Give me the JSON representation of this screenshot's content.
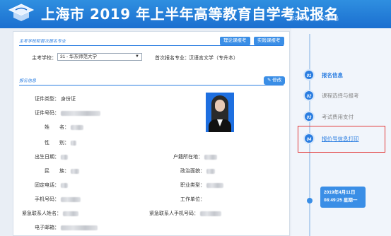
{
  "header": {
    "title": "上海市 2019 年上半年高等教育自学考试报名",
    "links": [
      "修改密码",
      "|",
      "安全退出"
    ]
  },
  "section1": {
    "title": "主考学校和首次报名专业",
    "buttons": [
      "理论课报考",
      "实践课报考"
    ],
    "school_label": "主考学校：",
    "school_value": "31 - 华东师范大学",
    "major_label": "首次报名专业：",
    "major_value": "汉语言文学（专升本）"
  },
  "section2": {
    "title": "报名信息",
    "edit_button": "修改",
    "fields": {
      "id_type_label": "证件类型：",
      "id_type_value": "身份证",
      "id_no_label": "证件号码：",
      "name_label": "姓　　名：",
      "gender_label": "性　　别：",
      "birth_label": "出生日期：",
      "ethnic_label": "民　　族：",
      "phone_label": "固定电话：",
      "mobile_label": "手机号码：",
      "emergency_name_label": "紧急联系人姓名：",
      "email_label": "电子邮箱：",
      "household_label": "户籍所在地：",
      "political_label": "政治面貌：",
      "occupation_label": "职业类型：",
      "workplace_label": "工作单位：",
      "emergency_mobile_label": "紧急联系人手机号码："
    }
  },
  "timeline": {
    "steps": [
      {
        "num": "01",
        "label": "报名信息"
      },
      {
        "num": "02",
        "label": "课程选择与报考"
      },
      {
        "num": "03",
        "label": "考试费用支付"
      },
      {
        "num": "04",
        "label": "报价号信息打印"
      }
    ],
    "date_line1": "2019年4月11日",
    "date_line2": "08:49:25 星期一"
  }
}
